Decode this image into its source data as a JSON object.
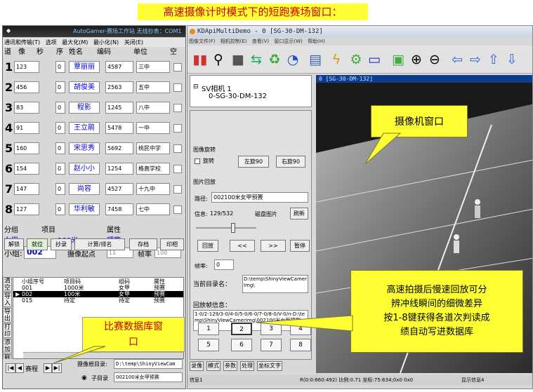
{
  "banner": "高速摄像计时模式下的短跑赛场窗口：",
  "left_window": {
    "title": "AutoGamer-赛场工作站  无线抄表：COM1",
    "menu": [
      "通讯和传输(T)",
      "选项",
      "最大化(M)",
      "最小化(N)",
      "关闭(E)"
    ],
    "header": {
      "lane": "道",
      "image": "像",
      "sec": "秒",
      "order": "序",
      "name": "姓名",
      "code": "编码",
      "unit": "单位",
      "blank": "空"
    },
    "athletes": [
      {
        "lane": "1",
        "image": "123",
        "sec": "0",
        "name": "覃丽丽",
        "code": "4587",
        "unit": "三中"
      },
      {
        "lane": "2",
        "image": "456",
        "sec": "0",
        "name": "胡俊美",
        "code": "2563",
        "unit": "五中"
      },
      {
        "lane": "3",
        "image": "83",
        "sec": "0",
        "name": "程影",
        "code": "1245",
        "unit": "八中"
      },
      {
        "lane": "4",
        "image": "91",
        "sec": "0",
        "name": "王立鹃",
        "code": "5478",
        "unit": "一中"
      },
      {
        "lane": "5",
        "image": "160",
        "sec": "0",
        "name": "宋思秀",
        "code": "5692",
        "unit": "桃民中学"
      },
      {
        "lane": "6",
        "image": "154",
        "sec": "0",
        "name": "赵小小",
        "code": "1254",
        "unit": "格直学校"
      },
      {
        "lane": "7",
        "image": "147",
        "sec": "0",
        "name": "尚容",
        "code": "4527",
        "unit": "十九中"
      },
      {
        "lane": "8",
        "image": "127",
        "sec": "0",
        "name": "华利敏",
        "code": "7458",
        "unit": "七中"
      }
    ],
    "group_label": "分组",
    "item_label": "项目",
    "attr_label": "属性",
    "group_value": "女甲",
    "item_value": "100米",
    "attr_value": "预赛",
    "subgroup_label": "小组:",
    "subgroup_value": "002",
    "start_label": "摄像起点",
    "start_value": "11",
    "fps_label": "帧率",
    "fps_value": "100",
    "buttons": [
      "解锁",
      "就位",
      "抄录",
      "计算/排名",
      "存档",
      "印相"
    ],
    "side_buttons": [
      "清空",
      "导入",
      "导出",
      "打印",
      "添加",
      "删除"
    ],
    "grid_headers": [
      "小组序号",
      "项目码",
      "组码",
      "属性"
    ],
    "grid_rows": [
      [
        "001",
        "1000米",
        "女甲",
        "预赛"
      ],
      [
        "002",
        "100米",
        "女甲",
        "预赛"
      ],
      [
        "015",
        "待定",
        "待定",
        "预赛"
      ]
    ],
    "nav": {
      "first": "|◀",
      "prev": "◀",
      "label": "赛程",
      "next": "▶",
      "last": "▶|"
    },
    "root_dir_label": "摄像根目录:",
    "root_dir_value": "D:\\temp\\ShinyViewCam",
    "sub_dir_label": "子目录",
    "sub_dir_value": "002100米女甲预赛"
  },
  "right_window": {
    "title": "KDApiMultiDemo - 0 [SG-30-DM-132]",
    "menu": [
      "图像文件(F)",
      "相机控制(E)",
      "查看(V)",
      "窗口显示(W)",
      "帮助(H)"
    ],
    "toolbar_icons": [
      "chart-icon",
      "search-icon",
      "camera-icon",
      "transfer-icon",
      "recycle-icon",
      "clock-icon",
      "stats-icon",
      "lightning-icon",
      "gear-icon",
      "monitor-icon",
      "fit-icon",
      "zoom-in-icon",
      "zoom-out-icon",
      "left-arrow-icon",
      "right-arrow-icon",
      "up-arrow-icon",
      "down-arrow-icon"
    ],
    "tree_root": "SV相机 1",
    "tree_child": "0-SG-30-DM-132",
    "rotate_label": "图像旋转",
    "rotate_check": "旋转",
    "rotate_left": "左旋90",
    "rotate_right": "右旋90",
    "playback_label": "图片回放",
    "path_label": "路径:",
    "path_value": "002100米女甲预赛",
    "info_label": "信息:",
    "info_value": "129/532",
    "disk_label": "磁盘图片",
    "refresh": "刷新",
    "play_back": "回放",
    "prev": "<<",
    "next": ">>",
    "pause": "暂停",
    "frame_label": "帧率:",
    "frame_value": "0",
    "cur_dir_label": "当前目录名：",
    "cur_dir_value": "D:\\temp\\ShinyViewCamerImg\\",
    "replay_info_label": "回放帧信息：",
    "replay_info_value": "1-0/2-129/3-0/4-0/5-0/6-0/7-0/8-0/V-0/n-D:\\temp\\ShinyViewCamerImg\\002100米女甲预赛\\",
    "keys": [
      "1",
      "2",
      "3",
      "4",
      "5",
      "6",
      "7",
      "8"
    ],
    "tabs": [
      "录像",
      "模式",
      "参数",
      "处理",
      "坐标文字"
    ],
    "video_title": "0 [SG-30-DM-132]",
    "status_left": "信息1",
    "status_mid": "R(0:0:660:492) 比例:0.71 坐标:75:634;0x0 0x0",
    "status_right": "显示信息4"
  },
  "callouts": {
    "camera": "摄像机窗口",
    "database": [
      "比赛数据库窗",
      "口"
    ],
    "replay": [
      "高速拍摄后慢速回放可分",
      "辨冲线瞬间的细微差异",
      "按1-8键获得各道次判读成",
      "绩自动写进数据库"
    ]
  }
}
